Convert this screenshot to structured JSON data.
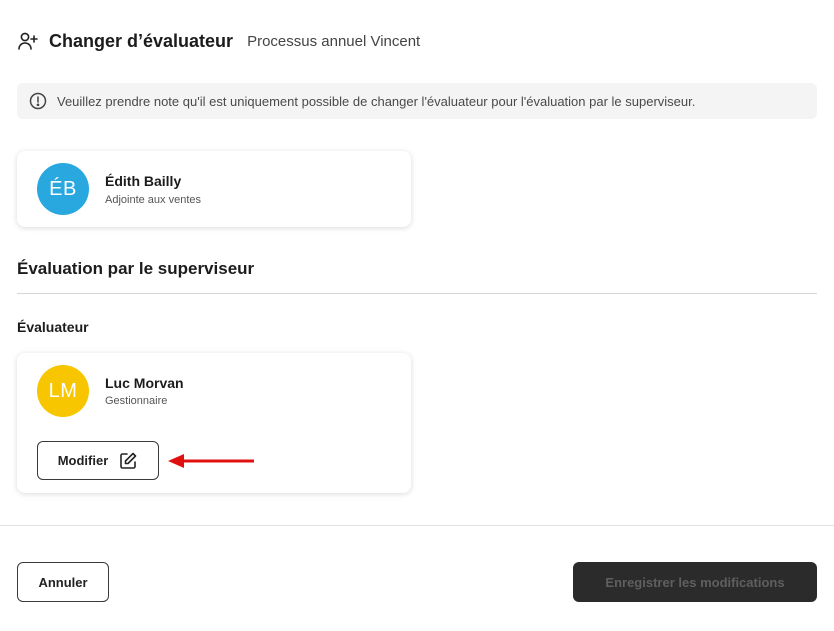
{
  "header": {
    "title": "Changer d’évaluateur",
    "subtitle": "Processus annuel Vincent",
    "icon": "user-plus-icon"
  },
  "notice": {
    "icon": "info-circle-icon",
    "text": "Veuillez prendre note qu'il est uniquement possible de changer l'évaluateur pour l'évaluation par le superviseur."
  },
  "employee": {
    "initials": "ÉB",
    "name": "Édith Bailly",
    "role": "Adjointe aux ventes",
    "avatar_color": "#29a8e0"
  },
  "section": {
    "title": "Évaluation par le superviseur",
    "field_label": "Évaluateur"
  },
  "evaluator": {
    "initials": "LM",
    "name": "Luc Morvan",
    "role": "Gestionnaire",
    "avatar_color": "#f7c600",
    "modify_label": "Modifier",
    "modify_icon": "edit-icon"
  },
  "annotation": {
    "arrow_color": "#e01010"
  },
  "footer": {
    "cancel_label": "Annuler",
    "save_label": "Enregistrer les modifications"
  }
}
